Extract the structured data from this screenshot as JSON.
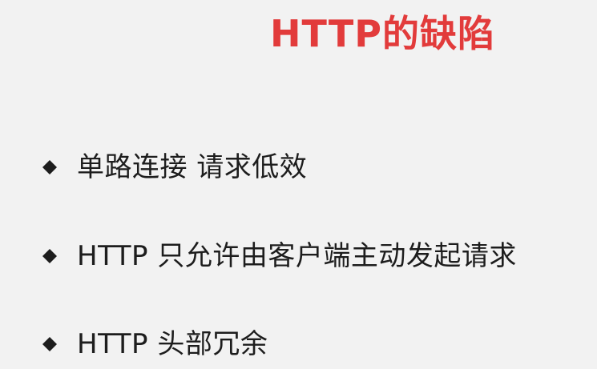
{
  "slide": {
    "title": "HTTP的缺陷",
    "bullets": [
      {
        "text": "单路连接 请求低效"
      },
      {
        "text": "HTTP 只允许由客户端主动发起请求"
      },
      {
        "text": "HTTP 头部冗余"
      }
    ],
    "colors": {
      "title": "#e23b3b",
      "text": "#1d1d1d",
      "background": "#f2f2f2"
    },
    "icons": {
      "bullet": "diamond-icon"
    }
  }
}
